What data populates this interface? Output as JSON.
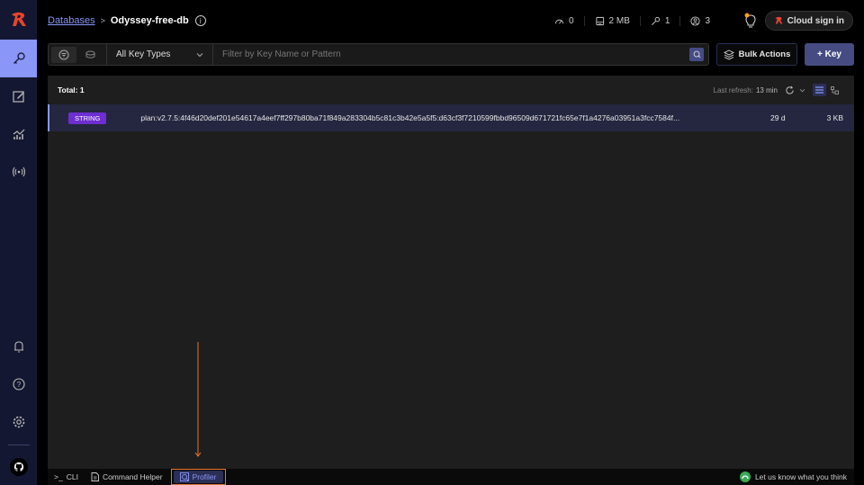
{
  "sidebar": {
    "items": [
      {
        "name": "browser",
        "icon": "key-icon",
        "active": true
      },
      {
        "name": "workbench",
        "icon": "edit-icon",
        "active": false
      },
      {
        "name": "analytics",
        "icon": "chart-icon",
        "active": false
      },
      {
        "name": "pubsub",
        "icon": "broadcast-icon",
        "active": false
      }
    ],
    "bottom": [
      "bell-icon",
      "help-icon",
      "gear-icon",
      "github-icon"
    ]
  },
  "header": {
    "breadcrumb_link": "Databases",
    "breadcrumb_sep": ">",
    "db_name": "Odyssey-free-db",
    "stats": {
      "ops": "0",
      "memory": "2 MB",
      "keys": "1",
      "clients": "3"
    },
    "cloud_sign_in": "Cloud sign in"
  },
  "toolbar": {
    "key_type": "All Key Types",
    "filter_placeholder": "Filter by Key Name or Pattern",
    "bulk_actions": "Bulk Actions",
    "add_key": "+ Key"
  },
  "list": {
    "total": "Total: 1",
    "last_refresh_label": "Last refresh:",
    "last_refresh_value": "13 min",
    "rows": [
      {
        "type": "STRING",
        "type_color": "#6d2fd0",
        "name": "plan:v2.7.5:4f46d20def201e54617a4eef7ff297b80ba71f849a283304b5c81c3b42e5a5f5:d63cf3f7210599fbbd96509d671721fc65e7f1a4276a03951a3fcc7584f...",
        "ttl": "29 d",
        "size": "3 KB"
      }
    ]
  },
  "bottombar": {
    "cli": "CLI",
    "command_helper": "Command Helper",
    "profiler": "Profiler",
    "feedback": "Let us know what you think"
  },
  "colors": {
    "accent": "#8a96f8",
    "annotation": "#e8742e",
    "brand": "#e8432e"
  }
}
